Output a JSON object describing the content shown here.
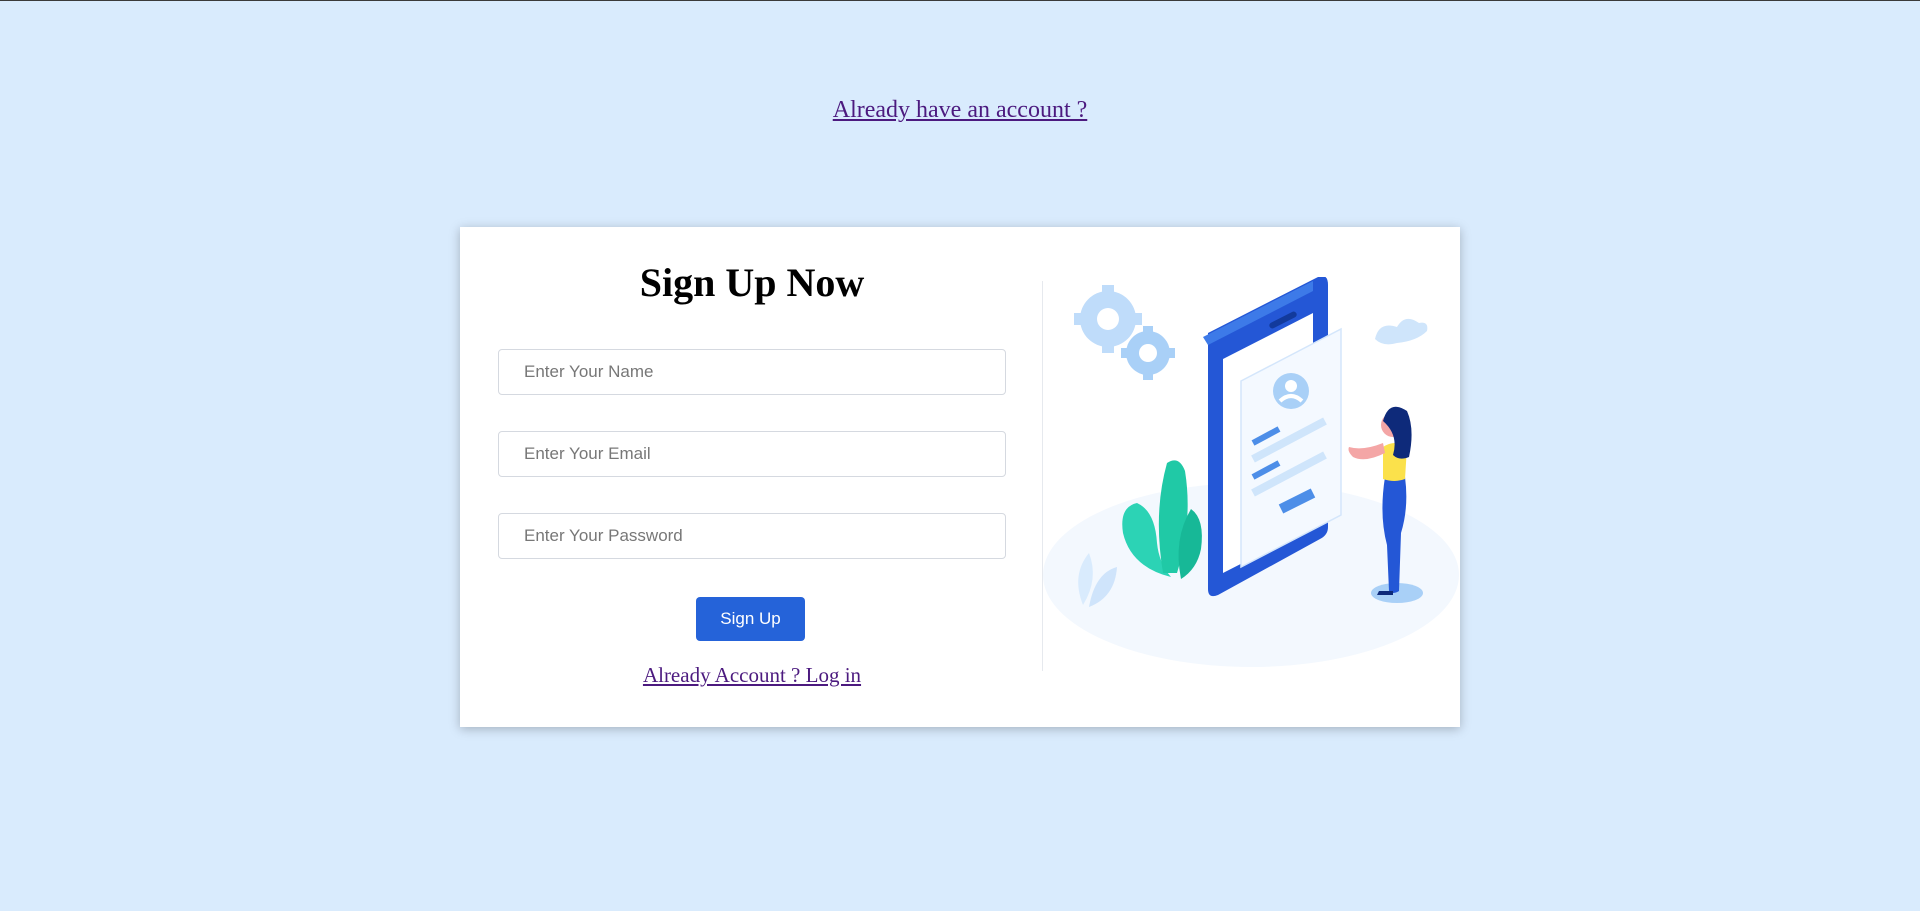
{
  "top_link": "Already have an account ?",
  "signup": {
    "title": "Sign Up Now",
    "name_placeholder": "Enter Your Name",
    "email_placeholder": "Enter Your Email",
    "password_placeholder": "Enter Your Password",
    "button_label": "Sign Up",
    "login_link": "Already Account ? Log in"
  },
  "colors": {
    "background": "#d9ebfd",
    "accent": "#2563d9",
    "link": "#4c1a7f"
  },
  "illustration": {
    "icons": [
      "gear-icon",
      "cloud-icon",
      "phone-icon",
      "avatar-icon",
      "plant-icon",
      "person-icon"
    ]
  }
}
